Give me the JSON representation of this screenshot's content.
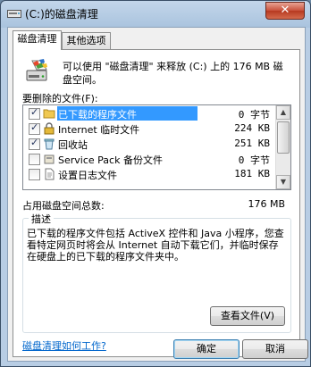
{
  "window": {
    "title": "(C:)的磁盘清理",
    "close_glyph": "✕"
  },
  "tabs": [
    {
      "label": "磁盘清理"
    },
    {
      "label": "其他选项"
    }
  ],
  "summary": {
    "line1": "可以使用 \"磁盘清理\" 来释放  (C:) 上的 176 MB 磁",
    "line2": "盘空间。"
  },
  "files_label": "要删除的文件(F):",
  "files": [
    {
      "name": "已下载的程序文件",
      "size": "0 字节",
      "checked": true,
      "selected": true,
      "icon": "folder-icon"
    },
    {
      "name": "Internet 临时文件",
      "size": "224 KB",
      "checked": true,
      "selected": false,
      "icon": "lock-icon"
    },
    {
      "name": "回收站",
      "size": "251 KB",
      "checked": true,
      "selected": false,
      "icon": "recycle-bin-icon"
    },
    {
      "name": "Service Pack 备份文件",
      "size": "0 字节",
      "checked": false,
      "selected": false,
      "icon": "package-icon"
    },
    {
      "name": "设置日志文件",
      "size": "181 KB",
      "checked": false,
      "selected": false,
      "icon": "document-icon"
    }
  ],
  "total": {
    "label": "占用磁盘空间总数:",
    "value": "176 MB"
  },
  "description": {
    "title": "描述",
    "text": "已下载的程序文件包括 ActiveX 控件和 Java 小程序，您查看特定网页时将会从 Internet 自动下载它们，并临时保存在硬盘上的已下载的程序文件夹中。"
  },
  "buttons": {
    "view_files": "查看文件(V)",
    "help_link": "磁盘清理如何工作?",
    "ok": "确定",
    "cancel": "取消"
  },
  "colors": {
    "selection": "#3399ff",
    "link": "#0066cc",
    "close": "#c8503a"
  }
}
